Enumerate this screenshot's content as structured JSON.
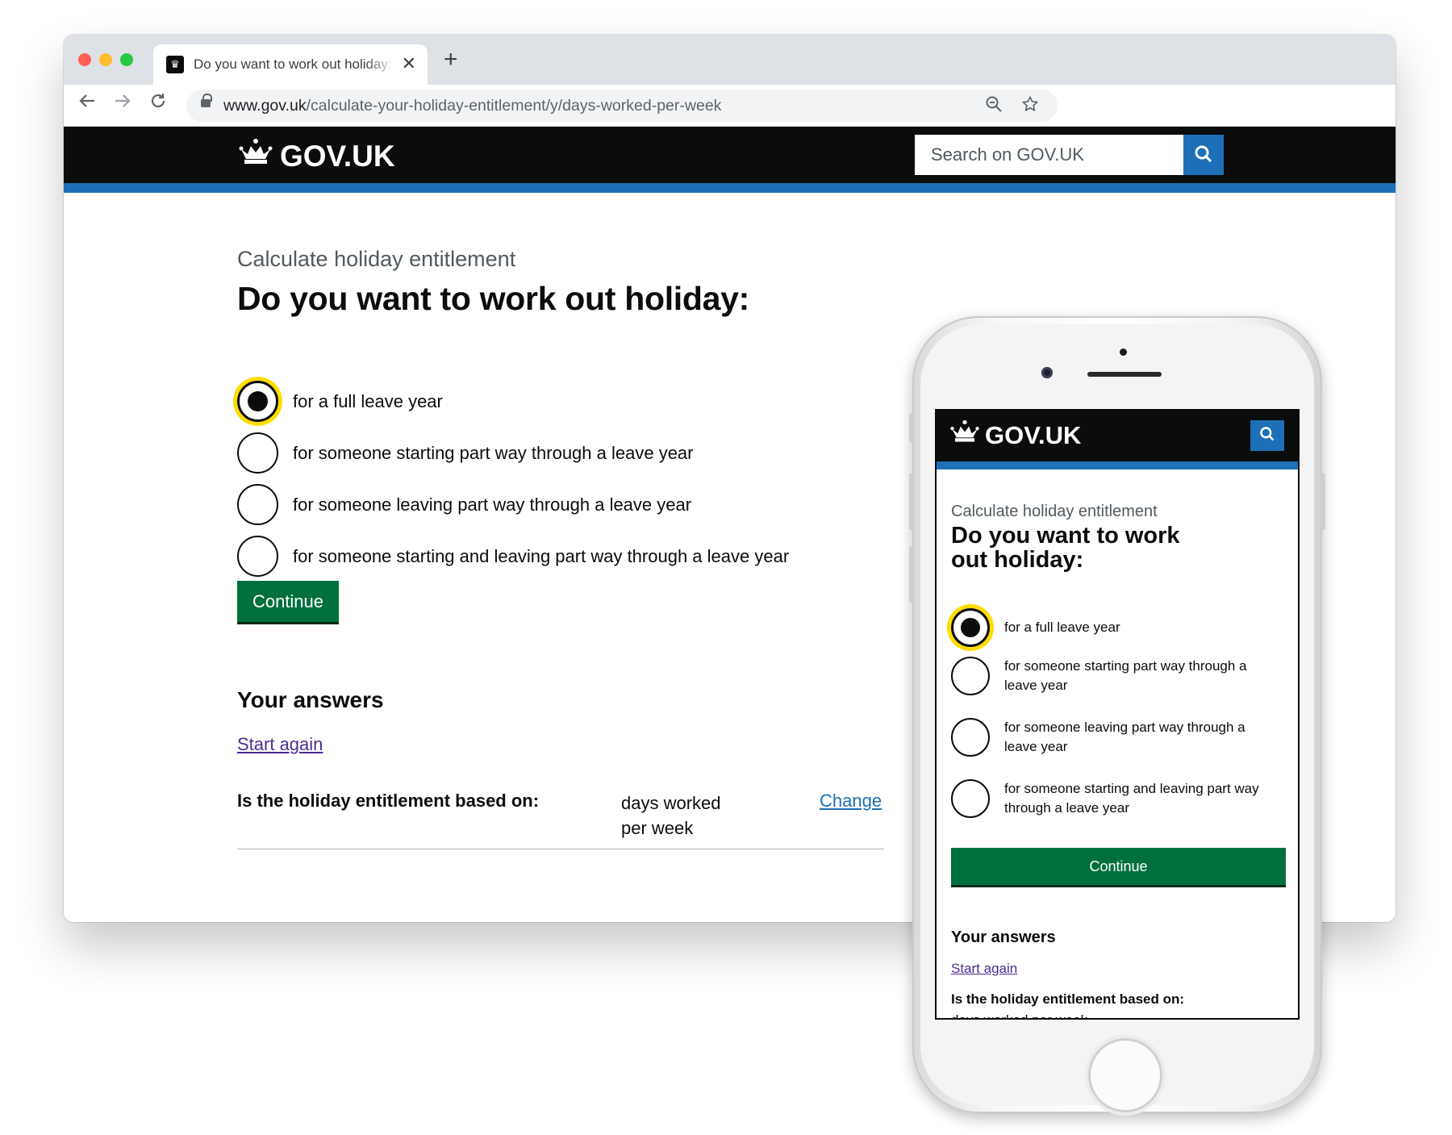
{
  "browser": {
    "tab_title": "Do you want to work out holiday: - Calculate holiday entitlement - GOV.UK",
    "new_tab_symbol": "+",
    "tab_close_symbol": "✕",
    "url_host": "www.gov.uk",
    "url_path": "/calculate-your-holiday-entitlement/y/days-worked-per-week"
  },
  "header": {
    "logo_text": "GOV.UK",
    "search_placeholder": "Search on GOV.UK"
  },
  "page": {
    "caption": "Calculate holiday entitlement",
    "heading": "Do you want to work out holiday:",
    "options": [
      {
        "label": "for a full leave year",
        "checked": true
      },
      {
        "label": "for someone starting part way through a leave year",
        "checked": false
      },
      {
        "label": "for someone leaving part way through a leave year",
        "checked": false
      },
      {
        "label": "for someone starting and leaving part way through a leave year",
        "checked": false
      }
    ],
    "continue_label": "Continue",
    "answers_heading": "Your answers",
    "start_again": "Start again",
    "summary": {
      "key": "Is the holiday entitlement based on:",
      "value": "days worked per week",
      "change": "Change"
    }
  },
  "mobile": {
    "logo_text": "GOV.UK",
    "caption": "Calculate holiday entitlement",
    "heading": "Do you want to work out holiday:",
    "options": [
      {
        "label": "for a full leave year",
        "checked": true
      },
      {
        "label": "for someone starting part way through a leave year",
        "checked": false
      },
      {
        "label": "for someone leaving part way through a leave year",
        "checked": false
      },
      {
        "label": "for someone starting and leaving part way through a leave year",
        "checked": false
      }
    ],
    "continue_label": "Continue",
    "answers_heading": "Your answers",
    "start_again": "Start again",
    "summary_key": "Is the holiday entitlement based on:",
    "summary_value": "days worked per week"
  },
  "colors": {
    "govuk_black": "#0b0c0c",
    "govuk_blue": "#1d70b8",
    "button_green": "#00703c",
    "focus_yellow": "#ffdd00",
    "visited_link": "#4c2c92",
    "secondary_text": "#505a5f"
  },
  "icons": {
    "traffic_lights": [
      "close-light-icon",
      "minimize-light-icon",
      "zoom-light-icon"
    ],
    "nav": [
      "back-arrow-icon",
      "forward-arrow-icon",
      "reload-icon"
    ],
    "omnibox": [
      "lock-icon",
      "zoom-out-icon",
      "bookmark-star-icon"
    ],
    "brand": "crown-icon",
    "search": "search-icon"
  }
}
